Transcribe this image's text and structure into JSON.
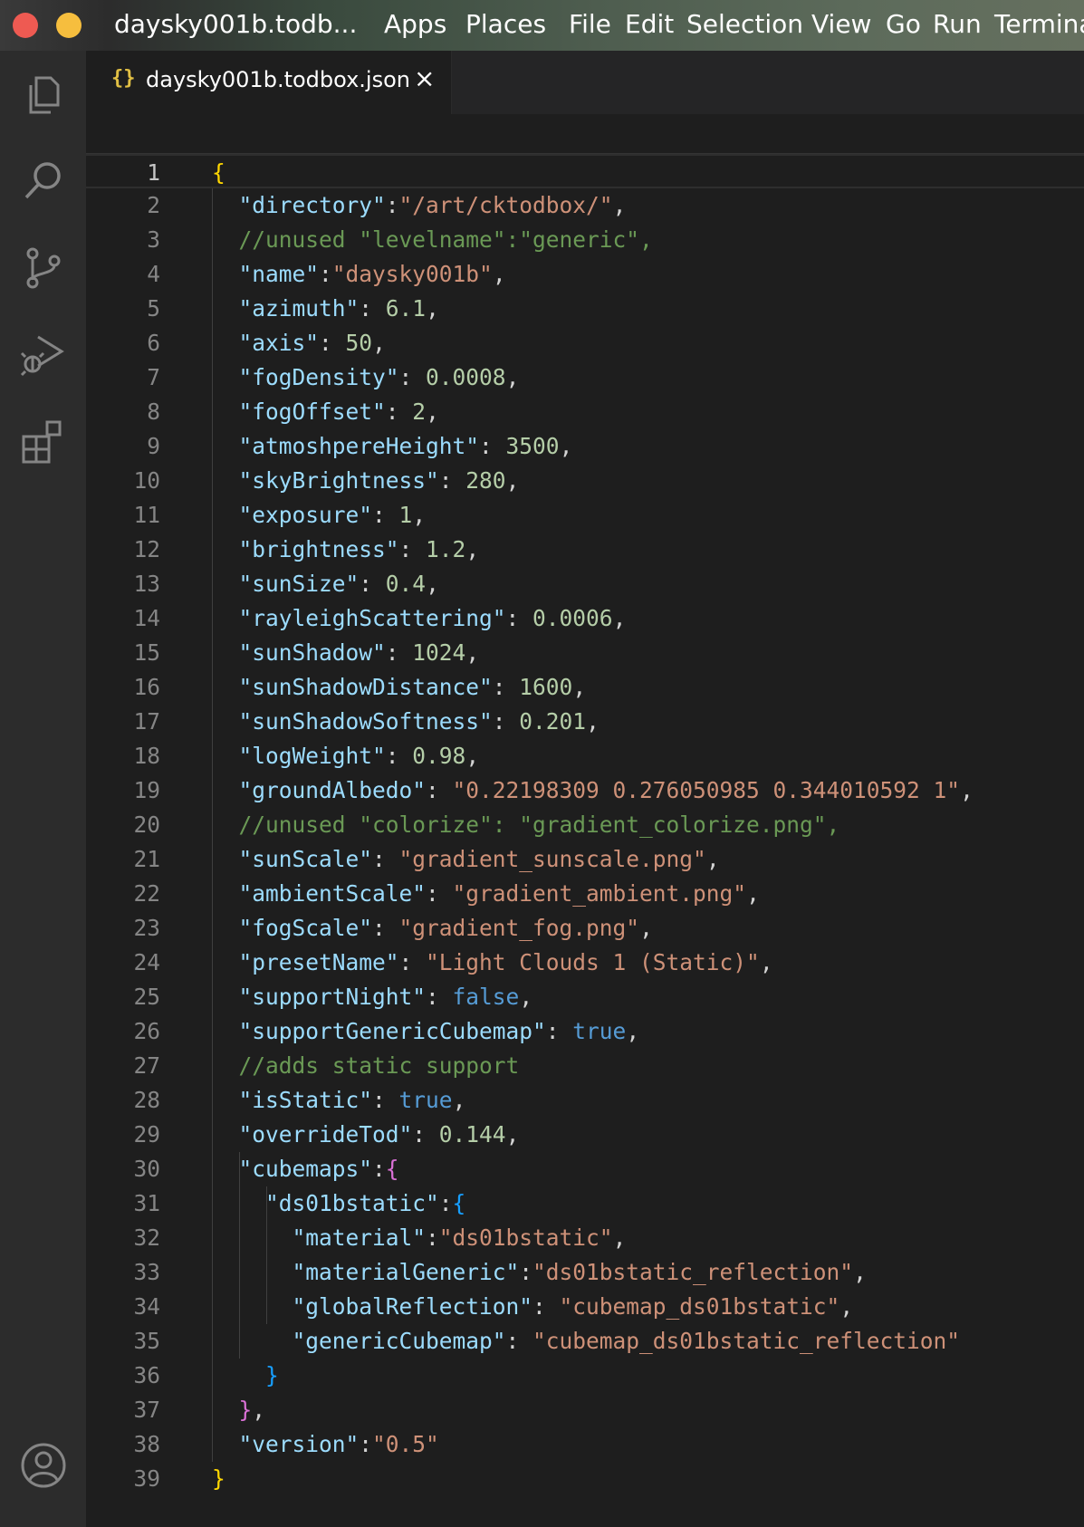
{
  "window": {
    "title": "daysky001b.todb...",
    "menus": [
      "Apps",
      "Places",
      "File",
      "Edit",
      "Selection",
      "View",
      "Go",
      "Run",
      "Termina"
    ]
  },
  "tab": {
    "icon": "{}",
    "label": "daysky001b.todbox.json",
    "close": "×"
  },
  "activity_bar": [
    "files-icon",
    "search-icon",
    "source-control-icon",
    "run-debug-icon",
    "extensions-icon",
    "account-icon"
  ],
  "editor": {
    "active_line": 1,
    "lines": [
      [
        [
          "br1",
          "{"
        ]
      ],
      [
        [
          "p",
          "  "
        ],
        [
          "k",
          "\"directory\""
        ],
        [
          "p",
          ":"
        ],
        [
          "s",
          "\"/art/cktodbox/\""
        ],
        [
          "p",
          ","
        ]
      ],
      [
        [
          "p",
          "  "
        ],
        [
          "c",
          "//unused \"levelname\":\"generic\","
        ]
      ],
      [
        [
          "p",
          "  "
        ],
        [
          "k",
          "\"name\""
        ],
        [
          "p",
          ":"
        ],
        [
          "s",
          "\"daysky001b\""
        ],
        [
          "p",
          ","
        ]
      ],
      [
        [
          "p",
          "  "
        ],
        [
          "k",
          "\"azimuth\""
        ],
        [
          "p",
          ": "
        ],
        [
          "n",
          "6.1"
        ],
        [
          "p",
          ","
        ]
      ],
      [
        [
          "p",
          "  "
        ],
        [
          "k",
          "\"axis\""
        ],
        [
          "p",
          ": "
        ],
        [
          "n",
          "50"
        ],
        [
          "p",
          ","
        ]
      ],
      [
        [
          "p",
          "  "
        ],
        [
          "k",
          "\"fogDensity\""
        ],
        [
          "p",
          ": "
        ],
        [
          "n",
          "0.0008"
        ],
        [
          "p",
          ","
        ]
      ],
      [
        [
          "p",
          "  "
        ],
        [
          "k",
          "\"fogOffset\""
        ],
        [
          "p",
          ": "
        ],
        [
          "n",
          "2"
        ],
        [
          "p",
          ","
        ]
      ],
      [
        [
          "p",
          "  "
        ],
        [
          "k",
          "\"atmoshpereHeight\""
        ],
        [
          "p",
          ": "
        ],
        [
          "n",
          "3500"
        ],
        [
          "p",
          ","
        ]
      ],
      [
        [
          "p",
          "  "
        ],
        [
          "k",
          "\"skyBrightness\""
        ],
        [
          "p",
          ": "
        ],
        [
          "n",
          "280"
        ],
        [
          "p",
          ","
        ]
      ],
      [
        [
          "p",
          "  "
        ],
        [
          "k",
          "\"exposure\""
        ],
        [
          "p",
          ": "
        ],
        [
          "n",
          "1"
        ],
        [
          "p",
          ","
        ]
      ],
      [
        [
          "p",
          "  "
        ],
        [
          "k",
          "\"brightness\""
        ],
        [
          "p",
          ": "
        ],
        [
          "n",
          "1.2"
        ],
        [
          "p",
          ","
        ]
      ],
      [
        [
          "p",
          "  "
        ],
        [
          "k",
          "\"sunSize\""
        ],
        [
          "p",
          ": "
        ],
        [
          "n",
          "0.4"
        ],
        [
          "p",
          ","
        ]
      ],
      [
        [
          "p",
          "  "
        ],
        [
          "k",
          "\"rayleighScattering\""
        ],
        [
          "p",
          ": "
        ],
        [
          "n",
          "0.0006"
        ],
        [
          "p",
          ","
        ]
      ],
      [
        [
          "p",
          "  "
        ],
        [
          "k",
          "\"sunShadow\""
        ],
        [
          "p",
          ": "
        ],
        [
          "n",
          "1024"
        ],
        [
          "p",
          ","
        ]
      ],
      [
        [
          "p",
          "  "
        ],
        [
          "k",
          "\"sunShadowDistance\""
        ],
        [
          "p",
          ": "
        ],
        [
          "n",
          "1600"
        ],
        [
          "p",
          ","
        ]
      ],
      [
        [
          "p",
          "  "
        ],
        [
          "k",
          "\"sunShadowSoftness\""
        ],
        [
          "p",
          ": "
        ],
        [
          "n",
          "0.201"
        ],
        [
          "p",
          ","
        ]
      ],
      [
        [
          "p",
          "  "
        ],
        [
          "k",
          "\"logWeight\""
        ],
        [
          "p",
          ": "
        ],
        [
          "n",
          "0.98"
        ],
        [
          "p",
          ","
        ]
      ],
      [
        [
          "p",
          "  "
        ],
        [
          "k",
          "\"groundAlbedo\""
        ],
        [
          "p",
          ": "
        ],
        [
          "s",
          "\"0.22198309 0.276050985 0.344010592 1\""
        ],
        [
          "p",
          ","
        ]
      ],
      [
        [
          "p",
          "  "
        ],
        [
          "c",
          "//unused \"colorize\": \"gradient_colorize.png\","
        ]
      ],
      [
        [
          "p",
          "  "
        ],
        [
          "k",
          "\"sunScale\""
        ],
        [
          "p",
          ": "
        ],
        [
          "s",
          "\"gradient_sunscale.png\""
        ],
        [
          "p",
          ","
        ]
      ],
      [
        [
          "p",
          "  "
        ],
        [
          "k",
          "\"ambientScale\""
        ],
        [
          "p",
          ": "
        ],
        [
          "s",
          "\"gradient_ambient.png\""
        ],
        [
          "p",
          ","
        ]
      ],
      [
        [
          "p",
          "  "
        ],
        [
          "k",
          "\"fogScale\""
        ],
        [
          "p",
          ": "
        ],
        [
          "s",
          "\"gradient_fog.png\""
        ],
        [
          "p",
          ","
        ]
      ],
      [
        [
          "p",
          "  "
        ],
        [
          "k",
          "\"presetName\""
        ],
        [
          "p",
          ": "
        ],
        [
          "s",
          "\"Light Clouds 1 (Static)\""
        ],
        [
          "p",
          ","
        ]
      ],
      [
        [
          "p",
          "  "
        ],
        [
          "k",
          "\"supportNight\""
        ],
        [
          "p",
          ": "
        ],
        [
          "b",
          "false"
        ],
        [
          "p",
          ","
        ]
      ],
      [
        [
          "p",
          "  "
        ],
        [
          "k",
          "\"supportGenericCubemap\""
        ],
        [
          "p",
          ": "
        ],
        [
          "b",
          "true"
        ],
        [
          "p",
          ","
        ]
      ],
      [
        [
          "p",
          "  "
        ],
        [
          "c",
          "//adds static support"
        ]
      ],
      [
        [
          "p",
          "  "
        ],
        [
          "k",
          "\"isStatic\""
        ],
        [
          "p",
          ": "
        ],
        [
          "b",
          "true"
        ],
        [
          "p",
          ","
        ]
      ],
      [
        [
          "p",
          "  "
        ],
        [
          "k",
          "\"overrideTod\""
        ],
        [
          "p",
          ": "
        ],
        [
          "n",
          "0.144"
        ],
        [
          "p",
          ","
        ]
      ],
      [
        [
          "p",
          "  "
        ],
        [
          "k",
          "\"cubemaps\""
        ],
        [
          "p",
          ":"
        ],
        [
          "br2",
          "{"
        ]
      ],
      [
        [
          "p",
          "    "
        ],
        [
          "k",
          "\"ds01bstatic\""
        ],
        [
          "p",
          ":"
        ],
        [
          "br3",
          "{"
        ]
      ],
      [
        [
          "p",
          "      "
        ],
        [
          "k",
          "\"material\""
        ],
        [
          "p",
          ":"
        ],
        [
          "s",
          "\"ds01bstatic\""
        ],
        [
          "p",
          ","
        ]
      ],
      [
        [
          "p",
          "      "
        ],
        [
          "k",
          "\"materialGeneric\""
        ],
        [
          "p",
          ":"
        ],
        [
          "s",
          "\"ds01bstatic_reflection\""
        ],
        [
          "p",
          ","
        ]
      ],
      [
        [
          "p",
          "      "
        ],
        [
          "k",
          "\"globalReflection\""
        ],
        [
          "p",
          ": "
        ],
        [
          "s",
          "\"cubemap_ds01bstatic\""
        ],
        [
          "p",
          ","
        ]
      ],
      [
        [
          "p",
          "      "
        ],
        [
          "k",
          "\"genericCubemap\""
        ],
        [
          "p",
          ": "
        ],
        [
          "s",
          "\"cubemap_ds01bstatic_reflection\""
        ]
      ],
      [
        [
          "p",
          "    "
        ],
        [
          "br3",
          "}"
        ]
      ],
      [
        [
          "p",
          "  "
        ],
        [
          "br2",
          "}"
        ],
        [
          "p",
          ","
        ]
      ],
      [
        [
          "p",
          "  "
        ],
        [
          "k",
          "\"version\""
        ],
        [
          "p",
          ":"
        ],
        [
          "s",
          "\"0.5\""
        ]
      ],
      [
        [
          "br1",
          "}"
        ]
      ]
    ]
  }
}
